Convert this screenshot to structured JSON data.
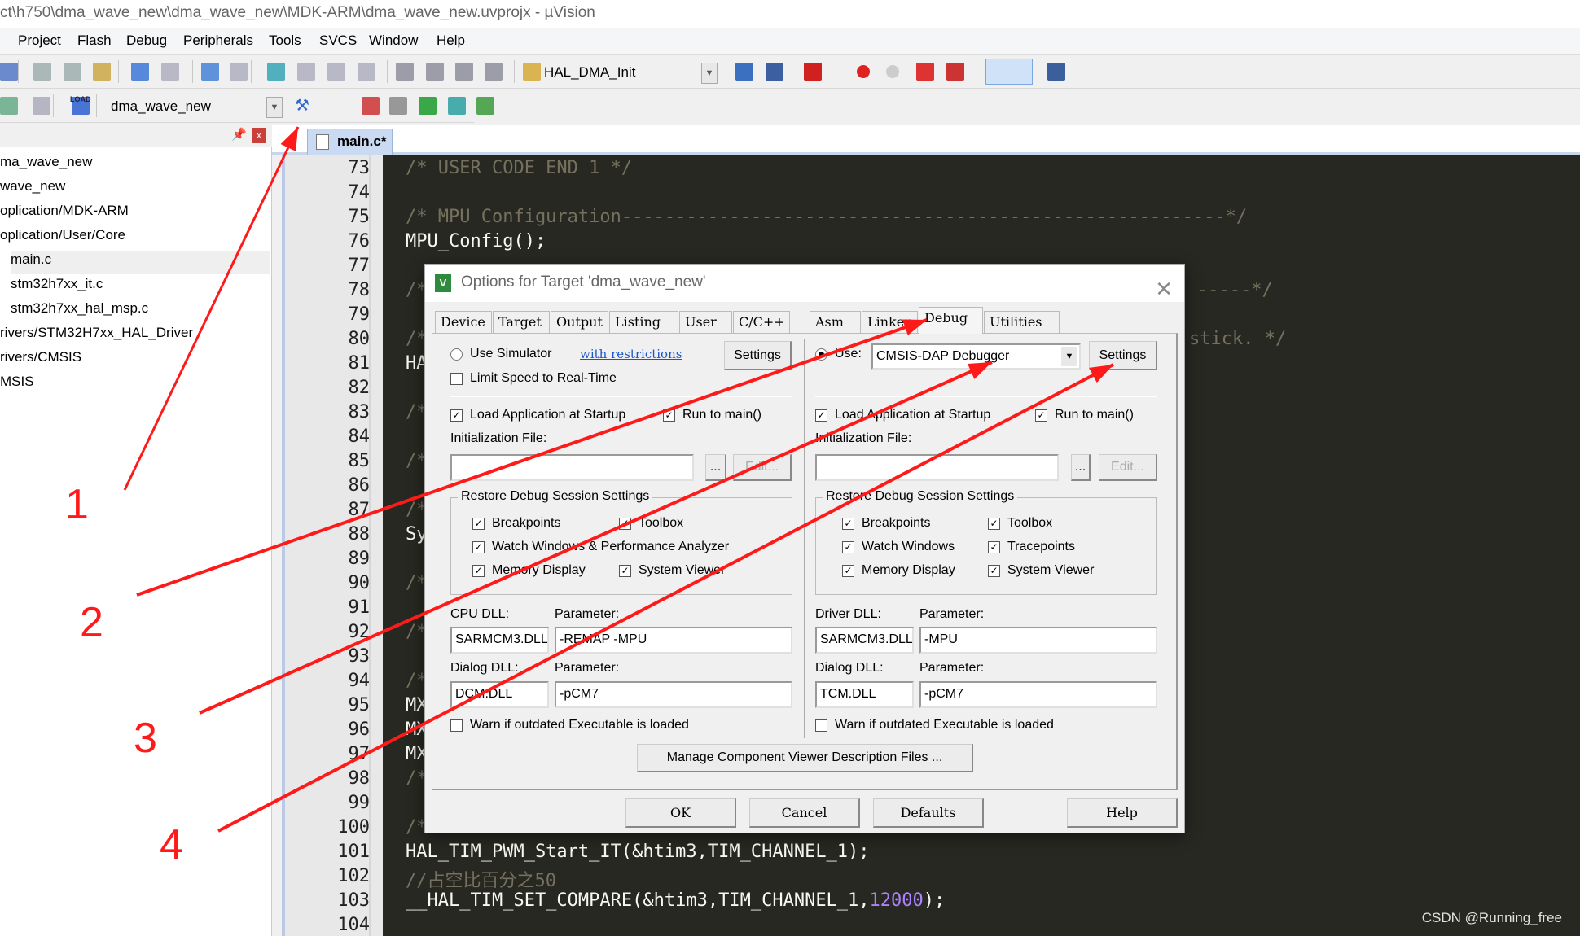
{
  "window": {
    "title": "ct\\h750\\dma_wave_new\\dma_wave_new\\MDK-ARM\\dma_wave_new.uvprojx - µVision"
  },
  "menu": [
    "Project",
    "Flash",
    "Debug",
    "Peripherals",
    "Tools",
    "SVCS",
    "Window",
    "Help"
  ],
  "toolbar1": {
    "icons": [
      "build-icon",
      "cut-icon",
      "copy-icon",
      "paste-icon",
      "undo-icon",
      "redo-icon",
      "back-icon",
      "forward-icon",
      "bookmark-icon",
      "prev-bookmark-icon",
      "next-bookmark-icon",
      "clear-bookmarks-icon",
      "indent-icon",
      "unindent-icon",
      "comment-icon",
      "uncomment-icon",
      "find-in-files-icon"
    ],
    "find_value": "HAL_DMA_Init",
    "icons_right": [
      "find-icon",
      "incremental-find-icon",
      "debug-start-icon",
      "breakpoint-icon",
      "disable-breakpoint-icon",
      "kill-breakpoints-icon",
      "disable-all-icon",
      "window-layout-icon",
      "configure-icon"
    ]
  },
  "toolbar2": {
    "target": "dma_wave_new",
    "icons": [
      "translate-icon",
      "batch-build-icon",
      "load-icon",
      "options-for-target-icon",
      "manage-components-icon",
      "file-extensions-icon",
      "select-packs-icon",
      "pack-installer-icon",
      "run-time-env-icon"
    ],
    "load_label": "LOAD"
  },
  "project_tree": [
    "ma_wave_new",
    "wave_new",
    "oplication/MDK-ARM",
    "oplication/User/Core",
    "main.c",
    "stm32h7xx_it.c",
    "stm32h7xx_hal_msp.c",
    "rivers/STM32H7xx_HAL_Driver",
    "rivers/CMSIS",
    "MSIS"
  ],
  "editor": {
    "tab": "main.c*",
    "lines": [
      {
        "n": "73",
        "t": "/* USER CODE END 1 */",
        "c": "cm"
      },
      {
        "n": "74",
        "t": ""
      },
      {
        "n": "75",
        "t": "/* MPU Configuration--------------------------------------------------------*/",
        "c": "cm"
      },
      {
        "n": "76",
        "t": "MPU_Config();"
      },
      {
        "n": "77",
        "t": ""
      },
      {
        "n": "78",
        "t": "/*",
        "c": "cm",
        "tail": "-----*/"
      },
      {
        "n": "79",
        "t": ""
      },
      {
        "n": "80",
        "t": "/*",
        "c": "cm",
        "tail": "stick. */"
      },
      {
        "n": "81",
        "t": "HA"
      },
      {
        "n": "82",
        "t": ""
      },
      {
        "n": "83",
        "t": "/*",
        "c": "cm"
      },
      {
        "n": "84",
        "t": ""
      },
      {
        "n": "85",
        "t": "/*",
        "c": "cm"
      },
      {
        "n": "86",
        "t": ""
      },
      {
        "n": "87",
        "t": "/*",
        "c": "cm"
      },
      {
        "n": "88",
        "t": "Sy"
      },
      {
        "n": "89",
        "t": ""
      },
      {
        "n": "90",
        "t": "/*",
        "c": "cm"
      },
      {
        "n": "91",
        "t": ""
      },
      {
        "n": "92",
        "t": "/*",
        "c": "cm"
      },
      {
        "n": "93",
        "t": ""
      },
      {
        "n": "94",
        "t": "/*",
        "c": "cm"
      },
      {
        "n": "95",
        "t": "MX"
      },
      {
        "n": "96",
        "t": "MX"
      },
      {
        "n": "97",
        "t": "MX"
      },
      {
        "n": "98",
        "t": "/*",
        "c": "cm"
      },
      {
        "n": "99",
        "t": ""
      },
      {
        "n": "100",
        "t": "/*",
        "c": "cm"
      },
      {
        "n": "101",
        "t": "HAL_TIM_PWM_Start_IT(&htim3,TIM_CHANNEL_1);"
      },
      {
        "n": "102",
        "t": "//占空比百分之50",
        "c": "cm"
      },
      {
        "n": "103",
        "t": "__HAL_TIM_SET_COMPARE(&htim3,TIM_CHANNEL_1,",
        "num": "12000",
        "after": ");"
      },
      {
        "n": "104",
        "t": ""
      }
    ]
  },
  "dialog": {
    "title": "Options for Target 'dma_wave_new'",
    "tabs": [
      "Device",
      "Target",
      "Output",
      "Listing",
      "User",
      "C/C++",
      "Asm",
      "Linker",
      "Debug",
      "Utilities"
    ],
    "active_tab": "Debug",
    "left": {
      "use_simulator": "Use Simulator",
      "with_restrictions": "with restrictions",
      "settings": "Settings",
      "limit_speed": "Limit Speed to Real-Time",
      "load_app": "Load Application at Startup",
      "run_to_main": "Run to main()",
      "init_file": "Initialization File:",
      "init_value": "",
      "browse": "...",
      "edit": "Edit...",
      "restore_group": "Restore Debug Session Settings",
      "breakpoints": "Breakpoints",
      "toolbox": "Toolbox",
      "watch": "Watch Windows & Performance Analyzer",
      "memory": "Memory Display",
      "system_viewer": "System Viewer",
      "cpu_dll_label": "CPU DLL:",
      "param_label": "Parameter:",
      "cpu_dll": "SARMCM3.DLL",
      "cpu_param": "-REMAP -MPU",
      "dialog_dll_label": "Dialog DLL:",
      "dialog_dll": "DCM.DLL",
      "dialog_param": "-pCM7",
      "warn": "Warn if outdated Executable is loaded",
      "use_simulator_selected": false,
      "limit_speed_checked": false,
      "load_app_checked": true,
      "run_to_main_checked": true,
      "breakpoints_checked": true,
      "toolbox_checked": true,
      "watch_checked": true,
      "memory_checked": true,
      "system_viewer_checked": true,
      "warn_checked": false
    },
    "right": {
      "use": "Use:",
      "debugger": "CMSIS-DAP Debugger",
      "settings": "Settings",
      "load_app": "Load Application at Startup",
      "run_to_main": "Run to main()",
      "init_file": "Initialization File:",
      "init_value": "",
      "browse": "...",
      "edit": "Edit...",
      "restore_group": "Restore Debug Session Settings",
      "breakpoints": "Breakpoints",
      "toolbox": "Toolbox",
      "watch": "Watch Windows",
      "tracepoints": "Tracepoints",
      "memory": "Memory Display",
      "system_viewer": "System Viewer",
      "driver_dll_label": "Driver DLL:",
      "param_label": "Parameter:",
      "driver_dll": "SARMCM3.DLL",
      "driver_param": "-MPU",
      "dialog_dll_label": "Dialog DLL:",
      "dialog_dll": "TCM.DLL",
      "dialog_param": "-pCM7",
      "warn": "Warn if outdated Executable is loaded",
      "use_selected": true
    },
    "manage_button": "Manage Component Viewer Description Files ...",
    "buttons": {
      "ok": "OK",
      "cancel": "Cancel",
      "defaults": "Defaults",
      "help": "Help"
    }
  },
  "annotations": {
    "labels": [
      "1",
      "2",
      "3",
      "4"
    ],
    "color": "#ff1a1a"
  },
  "watermark": "CSDN @Running_free",
  "colors": {
    "editor_bg": "#272822",
    "comment": "#75715e",
    "code": "#f8f8f2",
    "number": "#ae81ff"
  }
}
